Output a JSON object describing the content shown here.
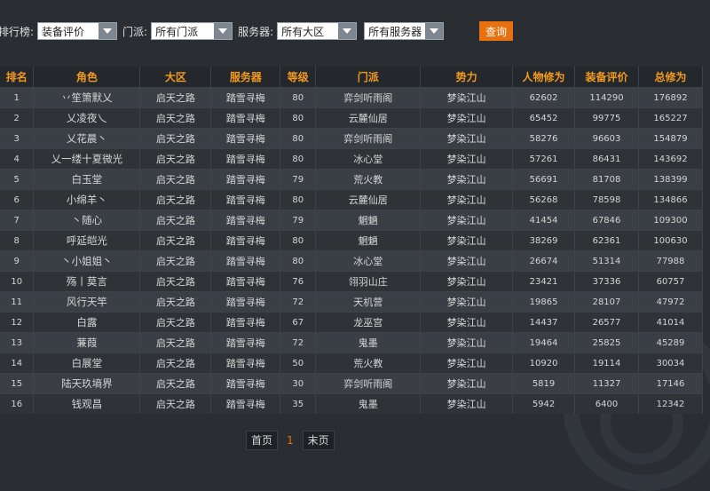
{
  "filters": {
    "rank_label": "排行榜:",
    "rank_value": "装备评价",
    "sect_label": "门派:",
    "sect_value": "所有门派",
    "server_label": "服务器:",
    "region_value": "所有大区",
    "server_value": "所有服务器",
    "query_button": "查询"
  },
  "table": {
    "headers": [
      "排名",
      "角色",
      "大区",
      "服务器",
      "等级",
      "门派",
      "势力",
      "人物修为",
      "装备评价",
      "总修为"
    ],
    "rows": [
      [
        "1",
        "丷笙箫默乂",
        "启天之路",
        "踏雪寻梅",
        "80",
        "弈剑听雨阁",
        "梦染江山",
        "62602",
        "114290",
        "176892"
      ],
      [
        "2",
        "乂凌夜乀",
        "启天之路",
        "踏雪寻梅",
        "80",
        "云麓仙居",
        "梦染江山",
        "65452",
        "99775",
        "165227"
      ],
      [
        "3",
        "乂花晨丶",
        "启天之路",
        "踏雪寻梅",
        "80",
        "弈剑听雨阁",
        "梦染江山",
        "58276",
        "96603",
        "154879"
      ],
      [
        "4",
        "乂一缕十夏微光",
        "启天之路",
        "踏雪寻梅",
        "80",
        "冰心堂",
        "梦染江山",
        "57261",
        "86431",
        "143692"
      ],
      [
        "5",
        "白玉堂",
        "启天之路",
        "踏雪寻梅",
        "79",
        "荒火教",
        "梦染江山",
        "56691",
        "81708",
        "138399"
      ],
      [
        "6",
        "小绵羊丶",
        "启天之路",
        "踏雪寻梅",
        "80",
        "云麓仙居",
        "梦染江山",
        "56268",
        "78598",
        "134866"
      ],
      [
        "7",
        "丶随心",
        "启天之路",
        "踏雪寻梅",
        "79",
        "魍魉",
        "梦染江山",
        "41454",
        "67846",
        "109300"
      ],
      [
        "8",
        "呼延皑光",
        "启天之路",
        "踏雪寻梅",
        "80",
        "魍魉",
        "梦染江山",
        "38269",
        "62361",
        "100630"
      ],
      [
        "9",
        "丶小姐姐丶",
        "启天之路",
        "踏雪寻梅",
        "80",
        "冰心堂",
        "梦染江山",
        "26674",
        "51314",
        "77988"
      ],
      [
        "10",
        "殇丨莫言",
        "启天之路",
        "踏雪寻梅",
        "76",
        "翎羽山庄",
        "梦染江山",
        "23421",
        "37336",
        "60757"
      ],
      [
        "11",
        "风行天竿",
        "启天之路",
        "踏雪寻梅",
        "72",
        "天机营",
        "梦染江山",
        "19865",
        "28107",
        "47972"
      ],
      [
        "12",
        "白露",
        "启天之路",
        "踏雪寻梅",
        "67",
        "龙巫宫",
        "梦染江山",
        "14437",
        "26577",
        "41014"
      ],
      [
        "13",
        "蒹葭",
        "启天之路",
        "踏雪寻梅",
        "72",
        "鬼墨",
        "梦染江山",
        "19464",
        "25825",
        "45289"
      ],
      [
        "14",
        "白展堂",
        "启天之路",
        "踏雪寻梅",
        "50",
        "荒火教",
        "梦染江山",
        "10920",
        "19114",
        "30034"
      ],
      [
        "15",
        "陆天玖墒界",
        "启天之路",
        "踏雪寻梅",
        "30",
        "弈剑听雨阁",
        "梦染江山",
        "5819",
        "11327",
        "17146"
      ],
      [
        "16",
        "钱观昌",
        "启天之路",
        "踏雪寻梅",
        "35",
        "鬼墨",
        "梦染江山",
        "5942",
        "6400",
        "12342"
      ]
    ]
  },
  "pager": {
    "first": "首页",
    "current": "1",
    "last": "末页"
  }
}
